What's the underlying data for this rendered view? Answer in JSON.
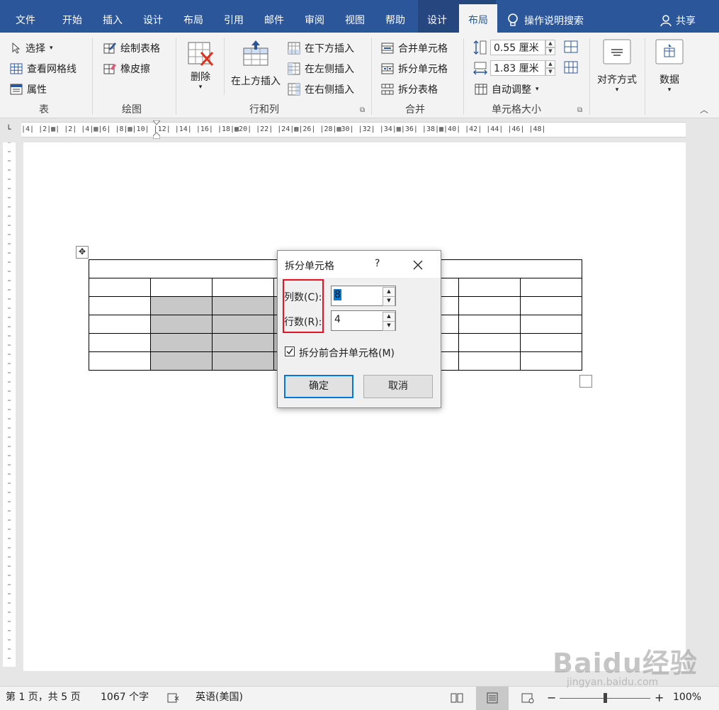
{
  "tabs": {
    "file": "文件",
    "home": "开始",
    "insert": "插入",
    "design": "设计",
    "layout": "布局",
    "references": "引用",
    "mailings": "邮件",
    "review": "审阅",
    "view": "视图",
    "help": "帮助",
    "table_design": "设计",
    "table_layout": "布局",
    "tell_me": "操作说明搜索",
    "share": "共享"
  },
  "ribbon": {
    "table_group": {
      "select": "选择",
      "view_gridlines": "查看网格线",
      "properties": "属性",
      "label": "表"
    },
    "draw_group": {
      "draw_table": "绘制表格",
      "eraser": "橡皮擦",
      "label": "绘图"
    },
    "rows_cols_group": {
      "delete": "删除",
      "insert_above": "在上方插入",
      "insert_below": "在下方插入",
      "insert_left": "在左侧插入",
      "insert_right": "在右侧插入",
      "label": "行和列"
    },
    "merge_group": {
      "merge_cells": "合并单元格",
      "split_cells": "拆分单元格",
      "split_table": "拆分表格",
      "label": "合并"
    },
    "cell_size_group": {
      "height": "0.55 厘米",
      "width": "1.83 厘米",
      "autofit": "自动调整",
      "label": "单元格大小"
    },
    "alignment": "对齐方式",
    "data": "数据"
  },
  "ruler": {
    "horizontal": "|4| |2|▦| |2| |4|▦|6| |8|▦|10| |12| |14| |16| |18|▦20| |22| |24|▦|26| |28|▦30| |32| |34|▦|36| |38|▦|40| |42| |44| |46| |48|"
  },
  "dialog": {
    "title": "拆分单元格",
    "help": "?",
    "columns_label": "列数(C):",
    "columns_value": "8",
    "rows_label": "行数(R):",
    "rows_value": "4",
    "merge_before_split": "拆分前合并单元格(M)",
    "ok": "确定",
    "cancel": "取消"
  },
  "status": {
    "page": "第 1 页，共 5 页",
    "word_count": "1067 个字",
    "language": "英语(美国)",
    "zoom": "100%"
  },
  "watermark": {
    "brand": "Baidu经验",
    "url": "jingyan.baidu.com"
  },
  "colors": {
    "accent": "#2b579a",
    "highlight_box": "#e81123",
    "shaded_cell": "#c8c8c8"
  }
}
